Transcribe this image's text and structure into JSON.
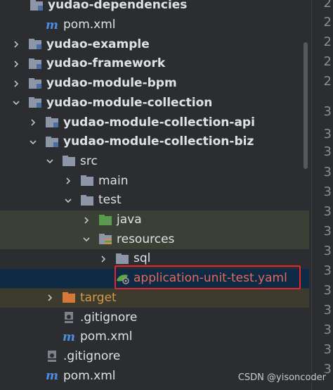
{
  "tree": {
    "rows": [
      {
        "label": "yudao-dependencies",
        "kind": "module-folder",
        "bold": true
      },
      {
        "label": "pom.xml",
        "kind": "maven"
      },
      {
        "label": "yudao-example",
        "kind": "module-folder",
        "bold": true,
        "chevron": "right"
      },
      {
        "label": "yudao-framework",
        "kind": "module-folder",
        "bold": true,
        "chevron": "right"
      },
      {
        "label": "yudao-module-bpm",
        "kind": "module-folder",
        "bold": true,
        "chevron": "right"
      },
      {
        "label": "yudao-module-collection",
        "kind": "module-folder",
        "bold": true,
        "chevron": "down"
      },
      {
        "label": "yudao-module-collection-api",
        "kind": "module-folder",
        "bold": true,
        "chevron": "right"
      },
      {
        "label": "yudao-module-collection-biz",
        "kind": "module-folder",
        "bold": true,
        "chevron": "down"
      },
      {
        "label": "src",
        "kind": "folder",
        "chevron": "down"
      },
      {
        "label": "main",
        "kind": "folder",
        "chevron": "right"
      },
      {
        "label": "test",
        "kind": "folder",
        "chevron": "down"
      },
      {
        "label": "java",
        "kind": "test-source-folder",
        "chevron": "right"
      },
      {
        "label": "resources",
        "kind": "test-resources-folder",
        "chevron": "down"
      },
      {
        "label": "sql",
        "kind": "folder",
        "chevron": "right"
      },
      {
        "label": "application-unit-test.yaml",
        "kind": "yaml-file"
      },
      {
        "label": "target",
        "kind": "excluded-folder",
        "chevron": "right"
      },
      {
        "label": ".gitignore",
        "kind": "gitignore"
      },
      {
        "label": "pom.xml",
        "kind": "maven"
      },
      {
        "label": ".gitignore",
        "kind": "gitignore"
      },
      {
        "label": "pom.xml",
        "kind": "maven"
      }
    ]
  },
  "gutter": {
    "numbers": [
      "2",
      "2",
      "2",
      "2",
      "2",
      "3",
      "3",
      "3",
      "3",
      "3",
      "3",
      "3",
      "3",
      "3",
      "3",
      "3",
      "3",
      "3",
      "3",
      "3"
    ]
  },
  "watermark": "CSDN @yisoncoder",
  "colors": {
    "background": "#2b2d30",
    "selected": "#0e2a45",
    "test_highlight": "#3a4036",
    "target_highlight": "#3d3a2e",
    "highlight_box": "#e8252a"
  }
}
